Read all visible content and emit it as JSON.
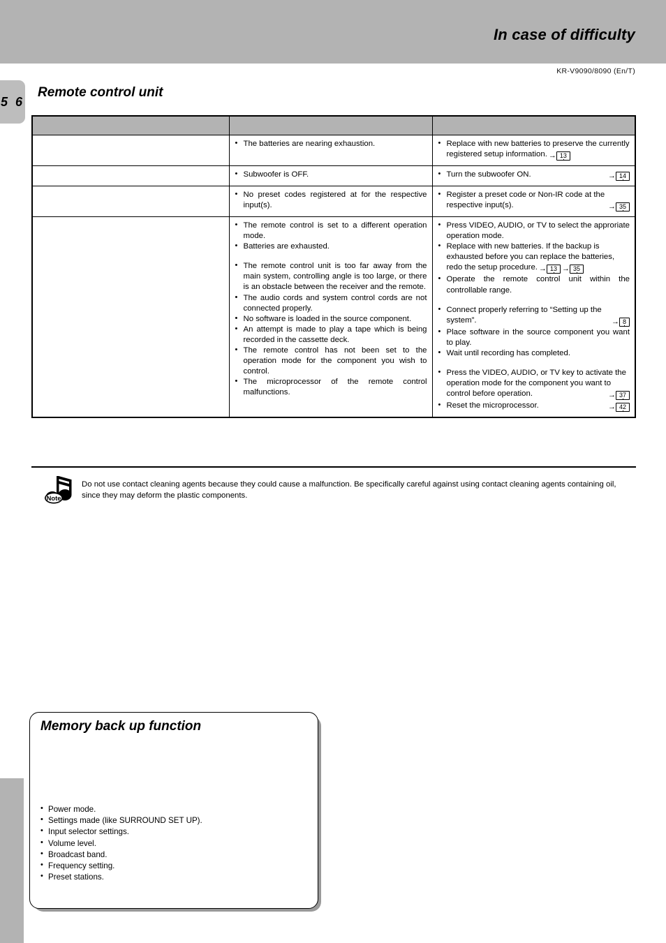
{
  "header": {
    "title": "In case of difficulty",
    "model_code": "KR-V9090/8090 (En/T)"
  },
  "page_tab": {
    "number": "5 6"
  },
  "section": {
    "heading": "Remote control unit"
  },
  "table": {
    "columns": [
      "",
      "",
      ""
    ],
    "rows": [
      {
        "symptom": "",
        "causes": [
          {
            "text": "The batteries are nearing exhaustion."
          }
        ],
        "actions": [
          {
            "text": "Replace with new batteries to preserve the currently registered setup information.",
            "refs": [
              "13"
            ]
          }
        ]
      },
      {
        "symptom": "",
        "causes": [
          {
            "text": "Subwoofer is OFF."
          }
        ],
        "actions": [
          {
            "text": "Turn the subwoofer ON.",
            "refs": [
              "14"
            ],
            "ref_right": true
          }
        ]
      },
      {
        "symptom": "",
        "causes": [
          {
            "text": "No preset codes registered at for the respective input(s)."
          }
        ],
        "actions": [
          {
            "text": "Register a preset code or Non-IR code at the respective input(s).",
            "refs": [
              "35"
            ],
            "ref_right": true
          }
        ]
      },
      {
        "symptom": "",
        "causes": [
          {
            "text": "The remote control is set to a different operation mode."
          },
          {
            "text": "Batteries are exhausted."
          },
          {
            "text": "The remote control unit is too far away from the main system, controlling angle is too large, or there is an obstacle between the receiver and the remote.",
            "gap": true
          },
          {
            "text": "The audio cords and system control cords are not connected properly."
          },
          {
            "text": "No software is loaded in the source component."
          },
          {
            "text": "An attempt is made to play a tape which is being recorded in the cassette deck."
          },
          {
            "text": "The remote control has not been set to the operation mode for the component you wish to control."
          },
          {
            "text": "The microprocessor of the remote control malfunctions."
          }
        ],
        "actions": [
          {
            "text": "Press VIDEO, AUDIO, or TV to select the approriate operation mode."
          },
          {
            "text": "Replace with new batteries. If the backup is exhausted before you can replace the batteries, redo the setup procedure.",
            "refs": [
              "13",
              "35"
            ]
          },
          {
            "text": "Operate the remote control unit within the controllable range."
          },
          {
            "text": "Connect properly referring to “Setting up the system”.",
            "refs": [
              "8"
            ],
            "ref_right": true,
            "gap": true
          },
          {
            "text": "Place software in the source component you want to play."
          },
          {
            "text": "Wait until recording has completed."
          },
          {
            "text": "Press the VIDEO, AUDIO, or TV key to activate the operation mode for the component you want to control before operation.",
            "refs": [
              "37"
            ],
            "ref_right": true,
            "gap": true
          },
          {
            "text": "Reset the microprocessor.",
            "refs": [
              "42"
            ],
            "ref_right": true
          }
        ]
      }
    ]
  },
  "note": {
    "icon": "music-note-icon",
    "badge": "Note",
    "text": "Do not use contact cleaning agents because they could cause a malfunction. Be specifically careful against using contact cleaning agents containing oil, since they may deform the plastic components."
  },
  "memory_box": {
    "title": "Memory back up function",
    "items": [
      "Power mode.",
      "Settings made (like SURROUND SET UP).",
      "Input selector settings.",
      "Volume level.",
      "Broadcast band.",
      "Frequency setting.",
      "Preset stations."
    ]
  },
  "colors": {
    "band_gray": "#b3b3b3",
    "tab_gray": "#bdbdbd",
    "shadow_gray": "#9a9a9a"
  }
}
